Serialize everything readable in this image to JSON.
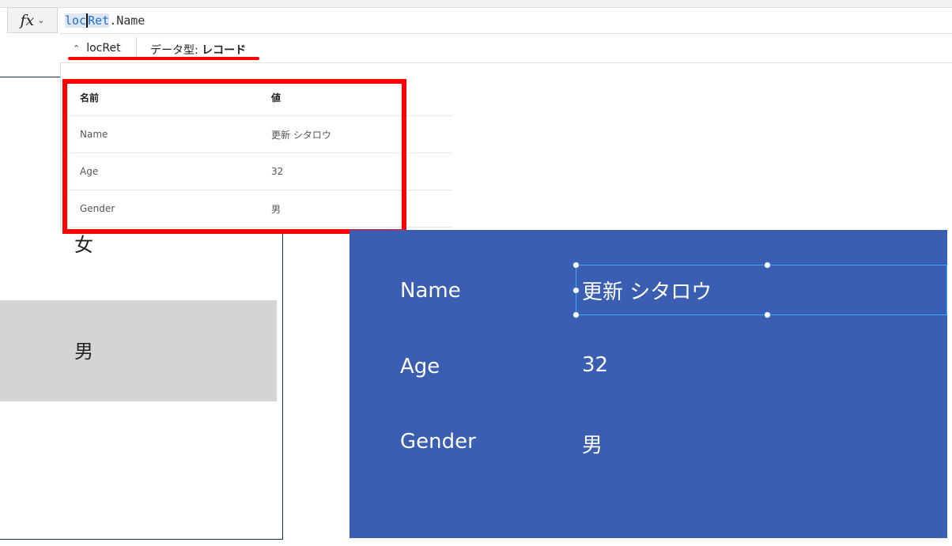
{
  "formula_bar": {
    "fx_label": "fx",
    "formula_var": "locRet",
    "formula_var_a": "loc",
    "formula_var_b": "Ret",
    "formula_rest": ".Name"
  },
  "result_header": {
    "toggle_label": "locRet",
    "type_prefix": "データ型: ",
    "type_value": "レコード"
  },
  "result_table": {
    "headers": [
      "名前",
      "値"
    ],
    "rows": [
      {
        "name": "Name",
        "value": "更新 シタロウ"
      },
      {
        "name": "Age",
        "value": "32"
      },
      {
        "name": "Gender",
        "value": "男"
      }
    ]
  },
  "gallery": {
    "items": [
      "女",
      "男"
    ]
  },
  "screen": {
    "fields": [
      {
        "label": "Name",
        "value": "更新 シタロウ"
      },
      {
        "label": "Age",
        "value": "32"
      },
      {
        "label": "Gender",
        "value": "男"
      }
    ]
  },
  "colors": {
    "screen_bg": "#3a5fb2",
    "highlight": "#ff0000",
    "selection": "#3fa9f5"
  }
}
